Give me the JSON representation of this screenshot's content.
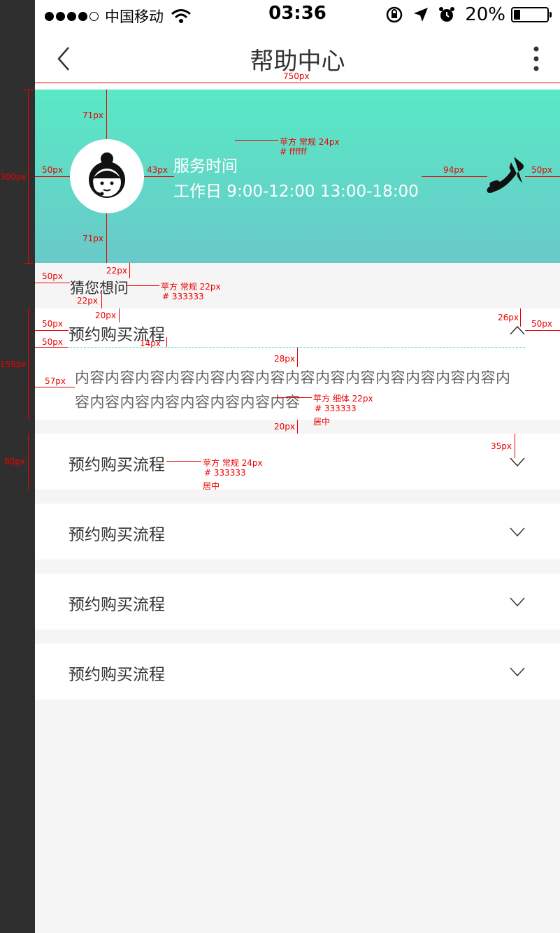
{
  "status_bar": {
    "carrier": "中国移动",
    "time": "03:36",
    "battery_percent": "20%",
    "battery_level": 0.2
  },
  "nav": {
    "title": "帮助中心",
    "back_icon": "chevron-left-icon",
    "more_icon": "more-vertical-icon"
  },
  "banner": {
    "service_label": "服务时间",
    "service_hours": "工作日 9:00-12:00 13:00-18:00",
    "gradient_top": "#59e9c5",
    "gradient_bottom": "#69c9c9",
    "phone_icon": "phone-icon"
  },
  "guess_label": "猜您想问",
  "faq": [
    {
      "question": "预约购买流程",
      "expanded": true,
      "answer": "内容内容内容内容内容内容内容内容内容内容内容内容内容内容内容内容内容内容内容内容内容内容"
    },
    {
      "question": "预约购买流程",
      "expanded": false
    },
    {
      "question": "预约购买流程",
      "expanded": false
    },
    {
      "question": "预约购买流程",
      "expanded": false
    },
    {
      "question": "预约购买流程",
      "expanded": false
    }
  ],
  "annotations": {
    "width_750": "750px",
    "h300": "300px",
    "t71a": "71px",
    "t71b": "71px",
    "l50a": "50px",
    "l43": "43px",
    "l94": "94px",
    "r50a": "50px",
    "font_title_1": "苹方 常规 24px",
    "font_title_2": "# ffffff",
    "t22a": "22px",
    "l50b": "50px",
    "font_guess_1": "苹方 常规 22px",
    "font_guess_2": "# 333333",
    "t22b": "22px",
    "t20a": "20px",
    "t26": "26px",
    "r50b": "50px",
    "l50c": "50px",
    "l50d": "50px",
    "t14": "14px",
    "t28": "28px",
    "h159": "159px",
    "l57": "57px",
    "font_ans_1": "苹方 细体 22px",
    "font_ans_2": "# 333333",
    "font_ans_3": "居中",
    "t20b": "20px",
    "t35": "35px",
    "h80": "80px",
    "font_q_1": "苹方 常规 24px",
    "font_q_2": "# 333333",
    "font_q_3": "居中"
  },
  "colors": {
    "page_bg": "#f5f5f5",
    "annotation": "#ee0000",
    "dash": "#5fd3c6"
  }
}
